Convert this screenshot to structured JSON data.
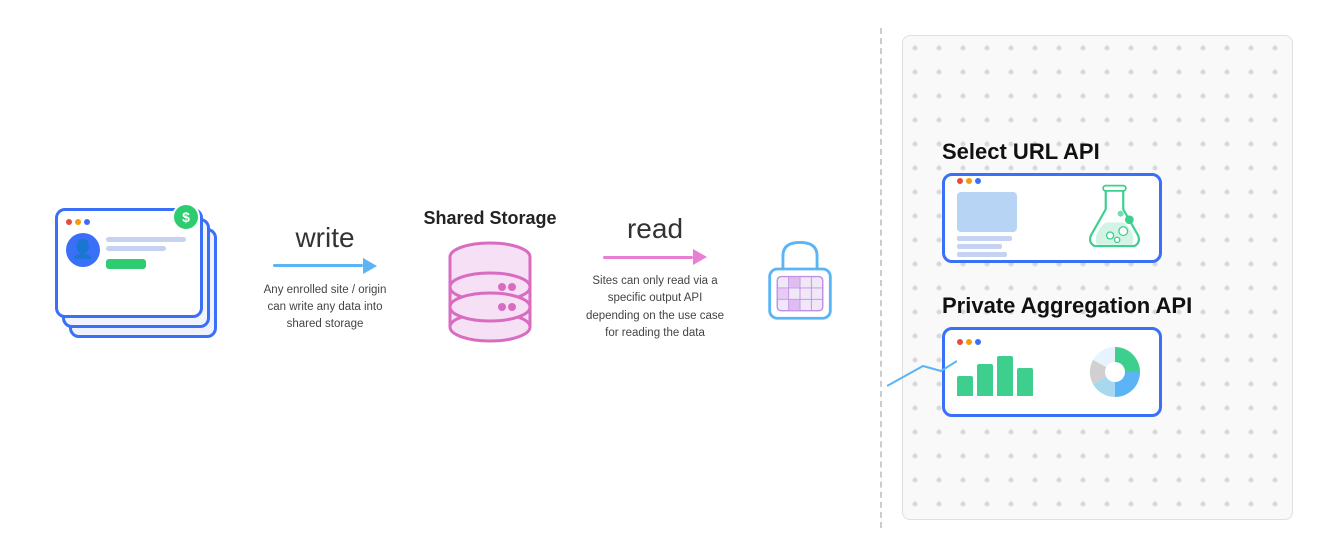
{
  "diagram": {
    "write_label": "write",
    "write_desc": "Any enrolled site / origin can write any data into shared storage",
    "read_label": "read",
    "read_desc": "Sites can only read via a specific output API depending on the use case for reading the data",
    "shared_storage_title": "Shared Storage"
  },
  "right_panel": {
    "api1": {
      "title": "Select URL API"
    },
    "api2": {
      "title": "Private Aggregation API"
    }
  },
  "icons": {
    "avatar": "👤",
    "coin": "$",
    "dot_red": "#e74c3c",
    "dot_yellow": "#f39c12",
    "dot_green_color": "#2ecc71",
    "db_stroke": "#d96cc0",
    "db_fill": "#f5e0f5",
    "arrow_blue": "#5ab4f5",
    "arrow_pink": "#e87fd4",
    "lock_color": "#5ab4f5",
    "bar1": "#3ecf8e",
    "bar2": "#3ecf8e",
    "bar3": "#3ecf8e",
    "bar4": "#3ecf8e",
    "pie_color": "#a0d8ef"
  }
}
